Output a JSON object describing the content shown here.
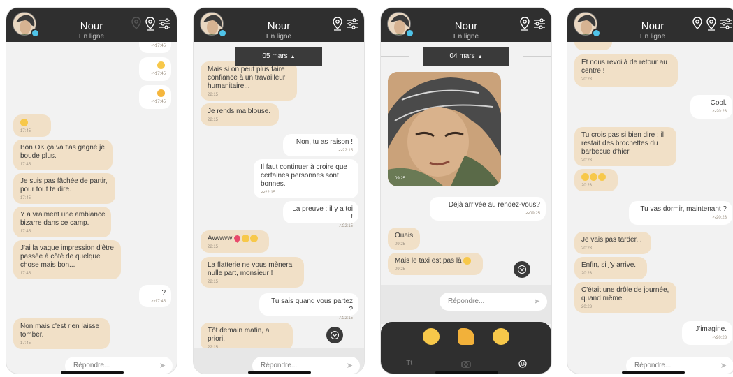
{
  "contact": {
    "name": "Nour",
    "status": "En ligne"
  },
  "reply_placeholder": "Répondre...",
  "colors": {
    "header": "#2f2f2f",
    "incoming": "#f1e0c7",
    "outgoing": "#ffffff",
    "online": "#4fc3e8"
  },
  "phone1": {
    "top_times": [
      "17:45"
    ],
    "emoji_time_1": "17:45",
    "emoji_time_2": "17:45",
    "in_emoji_time": "17:45",
    "m1": {
      "text": "Bon OK ça va t'as gagné je boude plus.",
      "time": "17:45"
    },
    "m2": {
      "text": "Je suis pas fâchée de partir, pour tout te dire.",
      "time": "17:45"
    },
    "m3": {
      "text": "Y a vraiment une ambiance bizarre dans ce camp.",
      "time": "17:45"
    },
    "m4": {
      "text": "J'ai la vague impression d'être passée à côté de quelque chose mais bon...",
      "time": "17:45"
    },
    "m5": {
      "text": "?",
      "time": "17:45"
    },
    "m6": {
      "text": "Non mais c'est rien laisse tomber.",
      "time": "17:45"
    }
  },
  "phone2": {
    "date": "05 mars",
    "m1": {
      "text": "Mais si on peut plus faire confiance à un travailleur humanitaire...",
      "time": "22:15"
    },
    "m2": {
      "text": "Je rends ma blouse.",
      "time": "22:15"
    },
    "m3": {
      "text": "Non, tu as raison !",
      "time": "22:15"
    },
    "m4": {
      "text": "Il faut continuer à croire que certaines personnes sont bonnes.",
      "time": "22:15"
    },
    "m5": {
      "text": "La preuve : il y a toi !",
      "time": "22:15"
    },
    "m6": {
      "text": "Awwww",
      "time": "22:15"
    },
    "m7": {
      "text": "La flatterie ne vous mènera nulle part, monsieur !",
      "time": "22:15"
    },
    "m8": {
      "text": "Tu sais quand vous partez ?",
      "time": "22:15"
    },
    "m9": {
      "text": "Tôt demain matin, a priori.",
      "time": "22:15"
    }
  },
  "phone3": {
    "date": "04 mars",
    "photo_time": "09:25",
    "m1": {
      "text": "Déjà arrivée au rendez-vous?",
      "time": "09:25"
    },
    "m2": {
      "text": "Ouais",
      "time": "09:25"
    },
    "m3": {
      "text": "Mais le taxi est pas là",
      "time": "09:25"
    },
    "tabs": [
      "Tt",
      "camera-icon",
      "emoji-icon"
    ]
  },
  "phone4": {
    "m1": {
      "text": "Et nous revoilà de retour au centre !",
      "time": "20:23"
    },
    "m2": {
      "text": "Cool.",
      "time": "20:23"
    },
    "m3": {
      "text": "Tu crois pas si bien dire : il restait des brochettes du barbecue d'hier",
      "time": "20:23"
    },
    "m4": {
      "text": "",
      "time": "20:23"
    },
    "m5": {
      "text": "Tu vas dormir, maintenant ?",
      "time": "20:23"
    },
    "m6": {
      "text": "Je vais pas tarder...",
      "time": "20:23"
    },
    "m7": {
      "text": "Enfin, si j'y arrive.",
      "time": "20:23"
    },
    "m8": {
      "text": "C'était une drôle de journée, quand même...",
      "time": "20:23"
    },
    "m9": {
      "text": "J'imagine.",
      "time": "20:23"
    }
  }
}
